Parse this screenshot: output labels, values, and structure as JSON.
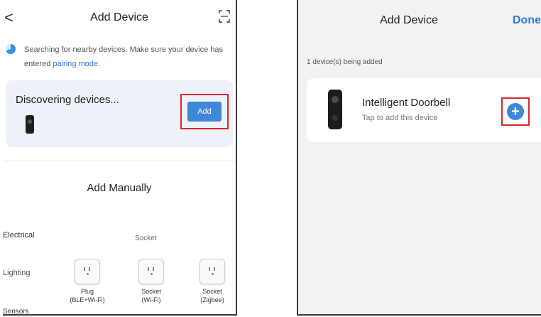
{
  "left": {
    "title": "Add Device",
    "back_glyph": "<",
    "search_text": "Searching for nearby devices. Make sure your device has entered",
    "pairing_link": "pairing mode",
    "search_suffix": ".",
    "discovering": "Discovering devices...",
    "add_button": "Add",
    "add_manually": "Add Manually",
    "categories": {
      "electrical": "Electrical",
      "lighting": "Lighting",
      "sensors": "Sensors"
    },
    "socket_header": "Socket",
    "devices": [
      {
        "line1": "Plug",
        "line2": "(BLE+Wi-Fi)"
      },
      {
        "line1": "Socket",
        "line2": "(Wi-Fi)"
      },
      {
        "line1": "Socket",
        "line2": "(Zigbee)"
      }
    ]
  },
  "right": {
    "title": "Add Device",
    "done": "Done",
    "count_text": "1 device(s) being added",
    "device_name": "Intelligent Doorbell",
    "device_hint": "Tap to add this device",
    "plus_glyph": "+"
  },
  "colors": {
    "accent": "#3f88d8",
    "link": "#2f7bd6",
    "highlight": "#d9262c",
    "card_bg": "#eef1f8"
  }
}
